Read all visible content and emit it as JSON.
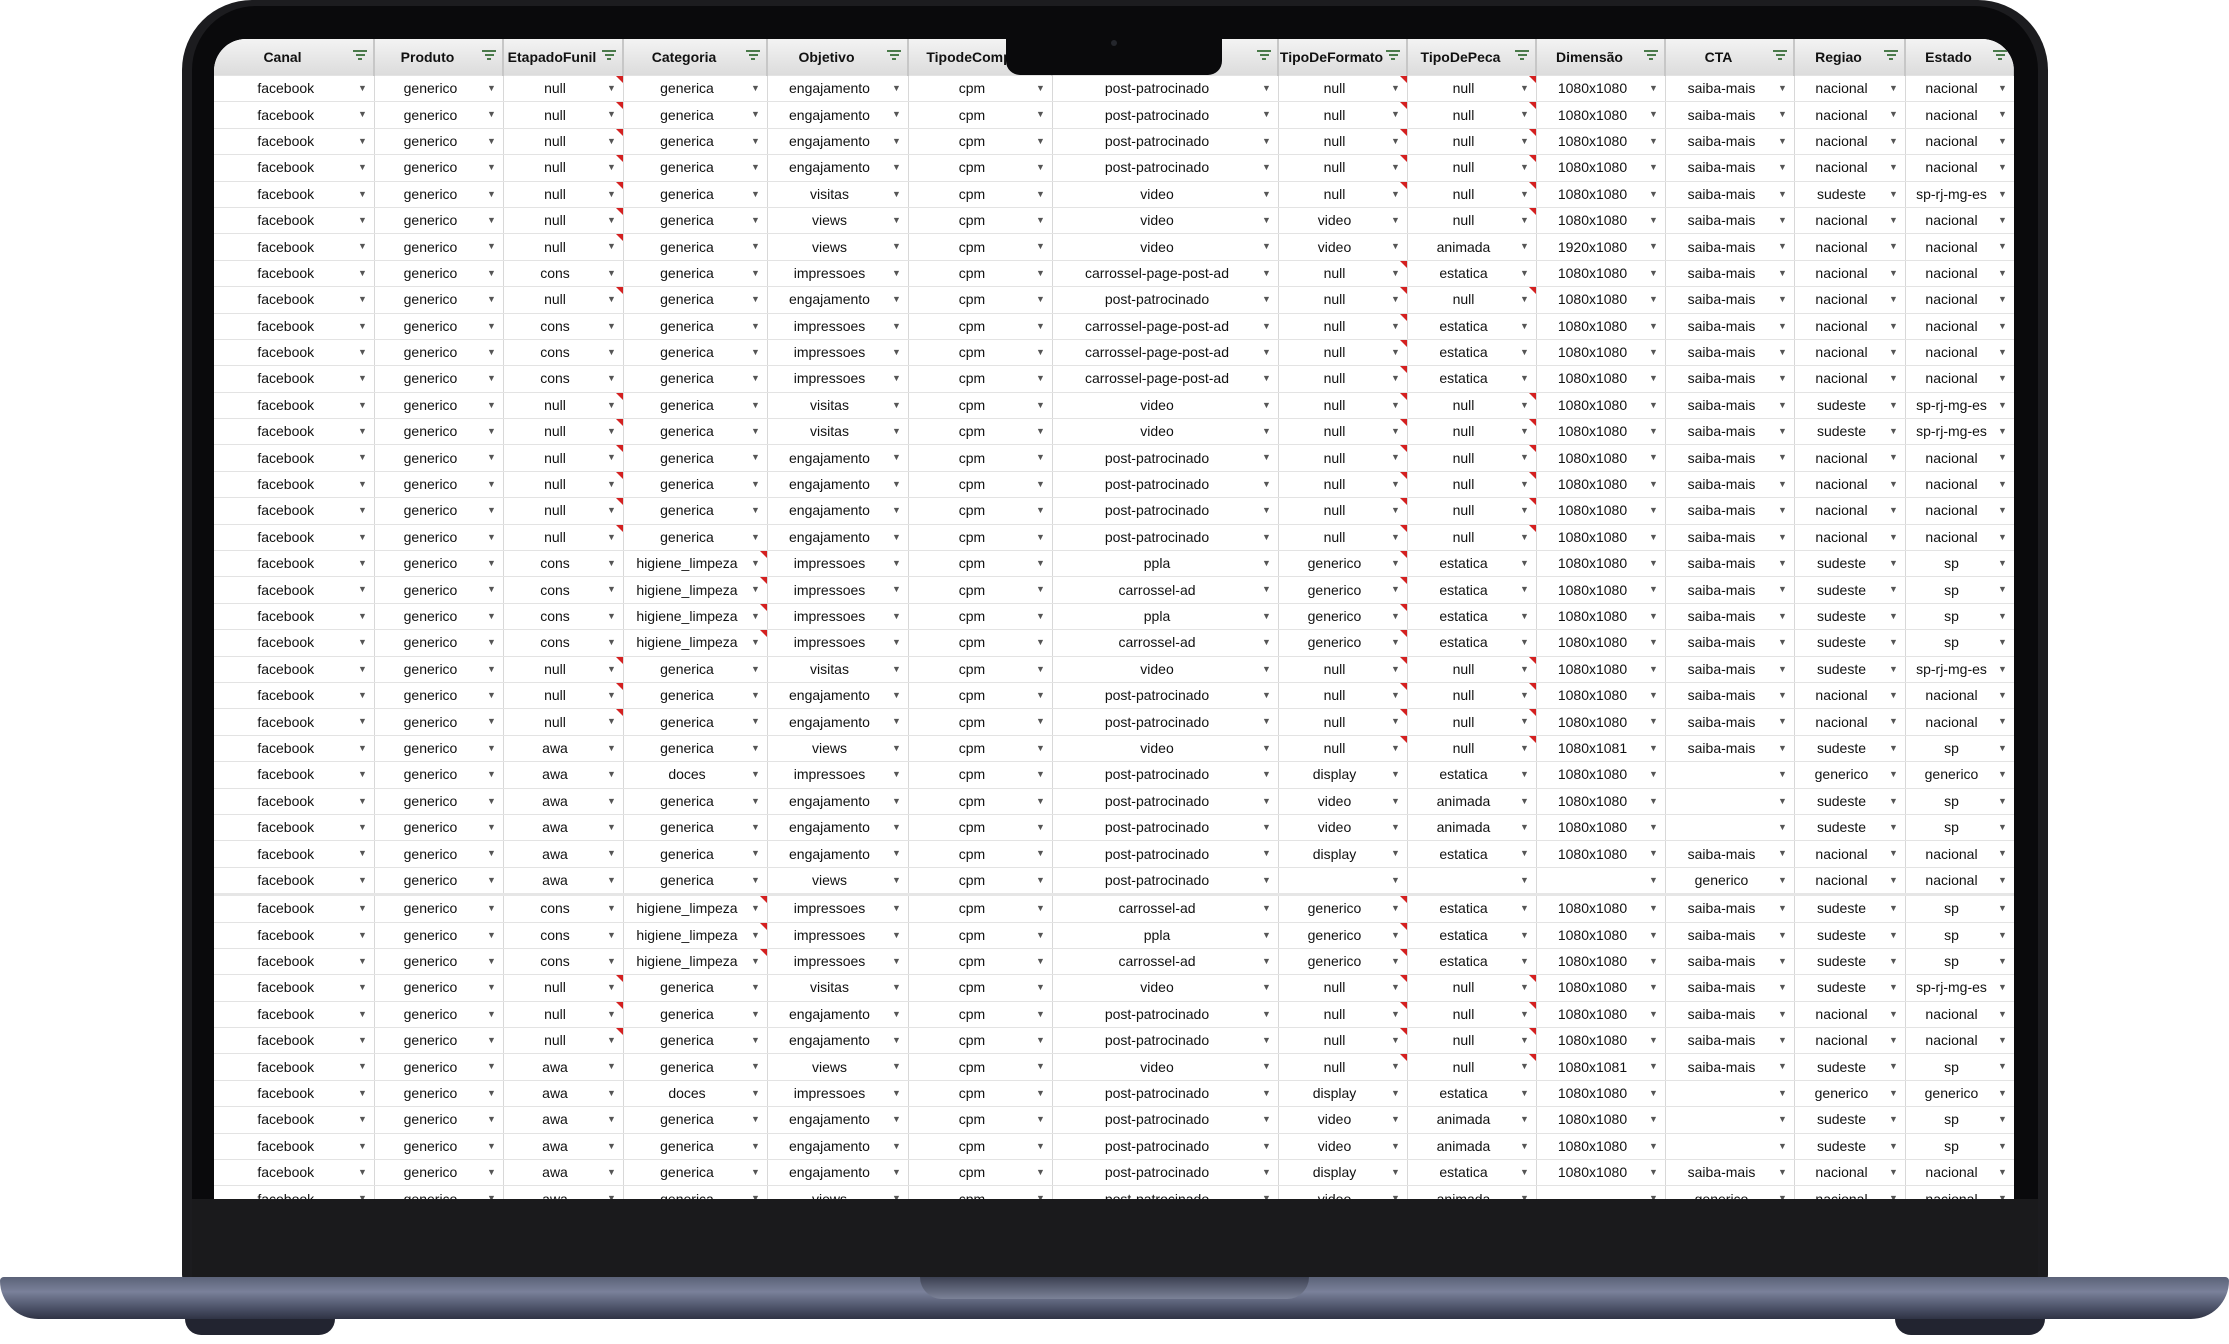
{
  "columns": [
    "Canal",
    "Produto",
    "EtapadoFunil",
    "Categoria",
    "Objetivo",
    "TipodeComp",
    "",
    "TipoDeFormato",
    "TipoDePeca",
    "Dimensão",
    "CTA",
    "Regiao",
    "Estado"
  ],
  "rows": [
    [
      "facebook",
      "generico",
      "null",
      "generica",
      "engajamento",
      "cpm",
      "post-patrocinado",
      "null",
      "null",
      "1080x1080",
      "saiba-mais",
      "nacional",
      "nacional"
    ],
    [
      "facebook",
      "generico",
      "null",
      "generica",
      "engajamento",
      "cpm",
      "post-patrocinado",
      "null",
      "null",
      "1080x1080",
      "saiba-mais",
      "nacional",
      "nacional"
    ],
    [
      "facebook",
      "generico",
      "null",
      "generica",
      "engajamento",
      "cpm",
      "post-patrocinado",
      "null",
      "null",
      "1080x1080",
      "saiba-mais",
      "nacional",
      "nacional"
    ],
    [
      "facebook",
      "generico",
      "null",
      "generica",
      "engajamento",
      "cpm",
      "post-patrocinado",
      "null",
      "null",
      "1080x1080",
      "saiba-mais",
      "nacional",
      "nacional"
    ],
    [
      "facebook",
      "generico",
      "null",
      "generica",
      "visitas",
      "cpm",
      "video",
      "null",
      "null",
      "1080x1080",
      "saiba-mais",
      "sudeste",
      "sp-rj-mg-es"
    ],
    [
      "facebook",
      "generico",
      "null",
      "generica",
      "views",
      "cpm",
      "video",
      "video",
      "null",
      "1080x1080",
      "saiba-mais",
      "nacional",
      "nacional"
    ],
    [
      "facebook",
      "generico",
      "null",
      "generica",
      "views",
      "cpm",
      "video",
      "video",
      "animada",
      "1920x1080",
      "saiba-mais",
      "nacional",
      "nacional"
    ],
    [
      "facebook",
      "generico",
      "cons",
      "generica",
      "impressoes",
      "cpm",
      "carrossel-page-post-ad",
      "null",
      "estatica",
      "1080x1080",
      "saiba-mais",
      "nacional",
      "nacional"
    ],
    [
      "facebook",
      "generico",
      "null",
      "generica",
      "engajamento",
      "cpm",
      "post-patrocinado",
      "null",
      "null",
      "1080x1080",
      "saiba-mais",
      "nacional",
      "nacional"
    ],
    [
      "facebook",
      "generico",
      "cons",
      "generica",
      "impressoes",
      "cpm",
      "carrossel-page-post-ad",
      "null",
      "estatica",
      "1080x1080",
      "saiba-mais",
      "nacional",
      "nacional"
    ],
    [
      "facebook",
      "generico",
      "cons",
      "generica",
      "impressoes",
      "cpm",
      "carrossel-page-post-ad",
      "null",
      "estatica",
      "1080x1080",
      "saiba-mais",
      "nacional",
      "nacional"
    ],
    [
      "facebook",
      "generico",
      "cons",
      "generica",
      "impressoes",
      "cpm",
      "carrossel-page-post-ad",
      "null",
      "estatica",
      "1080x1080",
      "saiba-mais",
      "nacional",
      "nacional"
    ],
    [
      "facebook",
      "generico",
      "null",
      "generica",
      "visitas",
      "cpm",
      "video",
      "null",
      "null",
      "1080x1080",
      "saiba-mais",
      "sudeste",
      "sp-rj-mg-es"
    ],
    [
      "facebook",
      "generico",
      "null",
      "generica",
      "visitas",
      "cpm",
      "video",
      "null",
      "null",
      "1080x1080",
      "saiba-mais",
      "sudeste",
      "sp-rj-mg-es"
    ],
    [
      "facebook",
      "generico",
      "null",
      "generica",
      "engajamento",
      "cpm",
      "post-patrocinado",
      "null",
      "null",
      "1080x1080",
      "saiba-mais",
      "nacional",
      "nacional"
    ],
    [
      "facebook",
      "generico",
      "null",
      "generica",
      "engajamento",
      "cpm",
      "post-patrocinado",
      "null",
      "null",
      "1080x1080",
      "saiba-mais",
      "nacional",
      "nacional"
    ],
    [
      "facebook",
      "generico",
      "null",
      "generica",
      "engajamento",
      "cpm",
      "post-patrocinado",
      "null",
      "null",
      "1080x1080",
      "saiba-mais",
      "nacional",
      "nacional"
    ],
    [
      "facebook",
      "generico",
      "null",
      "generica",
      "engajamento",
      "cpm",
      "post-patrocinado",
      "null",
      "null",
      "1080x1080",
      "saiba-mais",
      "nacional",
      "nacional"
    ],
    [
      "facebook",
      "generico",
      "cons",
      "higiene_limpeza",
      "impressoes",
      "cpm",
      "ppla",
      "generico",
      "estatica",
      "1080x1080",
      "saiba-mais",
      "sudeste",
      "sp"
    ],
    [
      "facebook",
      "generico",
      "cons",
      "higiene_limpeza",
      "impressoes",
      "cpm",
      "carrossel-ad",
      "generico",
      "estatica",
      "1080x1080",
      "saiba-mais",
      "sudeste",
      "sp"
    ],
    [
      "facebook",
      "generico",
      "cons",
      "higiene_limpeza",
      "impressoes",
      "cpm",
      "ppla",
      "generico",
      "estatica",
      "1080x1080",
      "saiba-mais",
      "sudeste",
      "sp"
    ],
    [
      "facebook",
      "generico",
      "cons",
      "higiene_limpeza",
      "impressoes",
      "cpm",
      "carrossel-ad",
      "generico",
      "estatica",
      "1080x1080",
      "saiba-mais",
      "sudeste",
      "sp"
    ],
    [
      "facebook",
      "generico",
      "null",
      "generica",
      "visitas",
      "cpm",
      "video",
      "null",
      "null",
      "1080x1080",
      "saiba-mais",
      "sudeste",
      "sp-rj-mg-es"
    ],
    [
      "facebook",
      "generico",
      "null",
      "generica",
      "engajamento",
      "cpm",
      "post-patrocinado",
      "null",
      "null",
      "1080x1080",
      "saiba-mais",
      "nacional",
      "nacional"
    ],
    [
      "facebook",
      "generico",
      "null",
      "generica",
      "engajamento",
      "cpm",
      "post-patrocinado",
      "null",
      "null",
      "1080x1080",
      "saiba-mais",
      "nacional",
      "nacional"
    ],
    [
      "facebook",
      "generico",
      "awa",
      "generica",
      "views",
      "cpm",
      "video",
      "null",
      "null",
      "1080x1081",
      "saiba-mais",
      "sudeste",
      "sp"
    ],
    [
      "facebook",
      "generico",
      "awa",
      "doces",
      "impressoes",
      "cpm",
      "post-patrocinado",
      "display",
      "estatica",
      "1080x1080",
      "",
      "generico",
      "generico"
    ],
    [
      "facebook",
      "generico",
      "awa",
      "generica",
      "engajamento",
      "cpm",
      "post-patrocinado",
      "video",
      "animada",
      "1080x1080",
      "",
      "sudeste",
      "sp"
    ],
    [
      "facebook",
      "generico",
      "awa",
      "generica",
      "engajamento",
      "cpm",
      "post-patrocinado",
      "video",
      "animada",
      "1080x1080",
      "",
      "sudeste",
      "sp"
    ],
    [
      "facebook",
      "generico",
      "awa",
      "generica",
      "engajamento",
      "cpm",
      "post-patrocinado",
      "display",
      "estatica",
      "1080x1080",
      "saiba-mais",
      "nacional",
      "nacional"
    ],
    [
      "facebook",
      "generico",
      "awa",
      "generica",
      "views",
      "cpm",
      "post-patrocinado",
      "",
      "",
      "",
      "generico",
      "nacional",
      "nacional"
    ],
    [
      "facebook",
      "generico",
      "cons",
      "higiene_limpeza",
      "impressoes",
      "cpm",
      "carrossel-ad",
      "generico",
      "estatica",
      "1080x1080",
      "saiba-mais",
      "sudeste",
      "sp"
    ],
    [
      "facebook",
      "generico",
      "cons",
      "higiene_limpeza",
      "impressoes",
      "cpm",
      "ppla",
      "generico",
      "estatica",
      "1080x1080",
      "saiba-mais",
      "sudeste",
      "sp"
    ],
    [
      "facebook",
      "generico",
      "cons",
      "higiene_limpeza",
      "impressoes",
      "cpm",
      "carrossel-ad",
      "generico",
      "estatica",
      "1080x1080",
      "saiba-mais",
      "sudeste",
      "sp"
    ],
    [
      "facebook",
      "generico",
      "null",
      "generica",
      "visitas",
      "cpm",
      "video",
      "null",
      "null",
      "1080x1080",
      "saiba-mais",
      "sudeste",
      "sp-rj-mg-es"
    ],
    [
      "facebook",
      "generico",
      "null",
      "generica",
      "engajamento",
      "cpm",
      "post-patrocinado",
      "null",
      "null",
      "1080x1080",
      "saiba-mais",
      "nacional",
      "nacional"
    ],
    [
      "facebook",
      "generico",
      "null",
      "generica",
      "engajamento",
      "cpm",
      "post-patrocinado",
      "null",
      "null",
      "1080x1080",
      "saiba-mais",
      "nacional",
      "nacional"
    ],
    [
      "facebook",
      "generico",
      "awa",
      "generica",
      "views",
      "cpm",
      "video",
      "null",
      "null",
      "1080x1081",
      "saiba-mais",
      "sudeste",
      "sp"
    ],
    [
      "facebook",
      "generico",
      "awa",
      "doces",
      "impressoes",
      "cpm",
      "post-patrocinado",
      "display",
      "estatica",
      "1080x1080",
      "",
      "generico",
      "generico"
    ],
    [
      "facebook",
      "generico",
      "awa",
      "generica",
      "engajamento",
      "cpm",
      "post-patrocinado",
      "video",
      "animada",
      "1080x1080",
      "",
      "sudeste",
      "sp"
    ],
    [
      "facebook",
      "generico",
      "awa",
      "generica",
      "engajamento",
      "cpm",
      "post-patrocinado",
      "video",
      "animada",
      "1080x1080",
      "",
      "sudeste",
      "sp"
    ],
    [
      "facebook",
      "generico",
      "awa",
      "generica",
      "engajamento",
      "cpm",
      "post-patrocinado",
      "display",
      "estatica",
      "1080x1080",
      "saiba-mais",
      "nacional",
      "nacional"
    ],
    [
      "facebook",
      "generico",
      "awa",
      "generica",
      "views",
      "cpm",
      "post-patrocinado",
      "video",
      "animada",
      "",
      "generico",
      "nacional",
      "nacional"
    ]
  ],
  "icons": {
    "filter": "filter-icon",
    "dropdown": "dropdown-arrow-icon",
    "comment": "comment-indicator-icon"
  },
  "colors": {
    "header_bg": "#dcdcdc",
    "comment_flag": "#d42020",
    "filter_icon": "#4a7a4a"
  }
}
